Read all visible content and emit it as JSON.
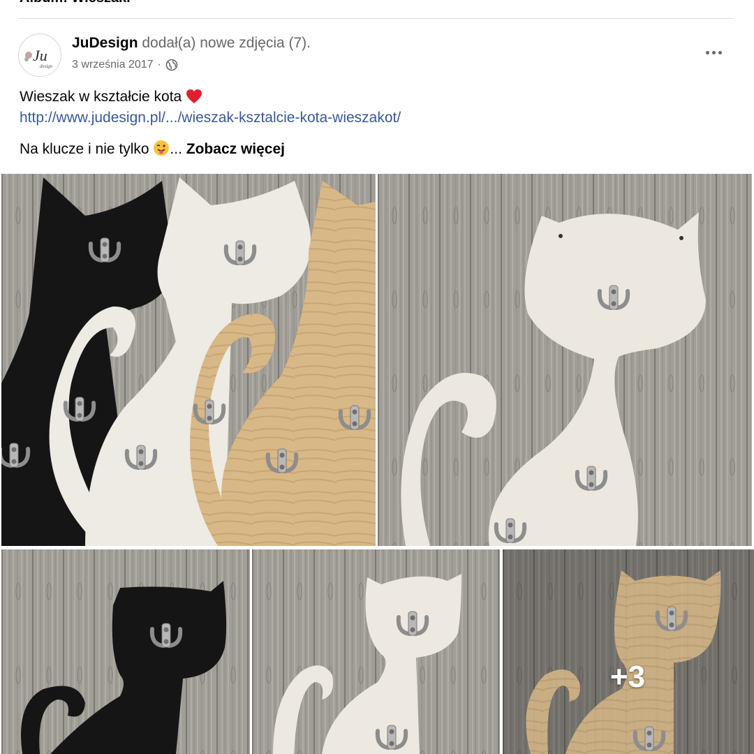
{
  "post": {
    "author": "JuDesign",
    "action": "dodał(a) nowe zdjęcia (7).",
    "date": "3 września 2017",
    "separator": "·",
    "privacy_icon": "globe-icon",
    "menu_icon": "more-icon",
    "avatar_text": "Ju",
    "avatar_subtext": "design"
  },
  "text": {
    "line1": "Wieszak w kształcie kota",
    "line1_emoji": "heart-icon",
    "link": "http://www.judesign.pl/.../wieszak-ksztalcie-kota-wieszakot/",
    "line3": "Na klucze i nie tylko",
    "line3_emoji": "winking-tongue-emoji",
    "ellipsis": "...",
    "see_more": "Zobacz więcej"
  },
  "photos": {
    "more_count": "+3",
    "items": [
      "three-cat-hangers",
      "white-cat-hanger",
      "black-cat-hanger",
      "white-cat-hanger-small",
      "wooden-cat-hanger"
    ]
  },
  "colors": {
    "link": "#385898",
    "secondary_text": "#65676b",
    "wood_background": "#a39e98",
    "cat_black": "#141414",
    "cat_white": "#f0ece6",
    "cat_wood": "#d9b98a",
    "hook": "#9a9a9a"
  }
}
